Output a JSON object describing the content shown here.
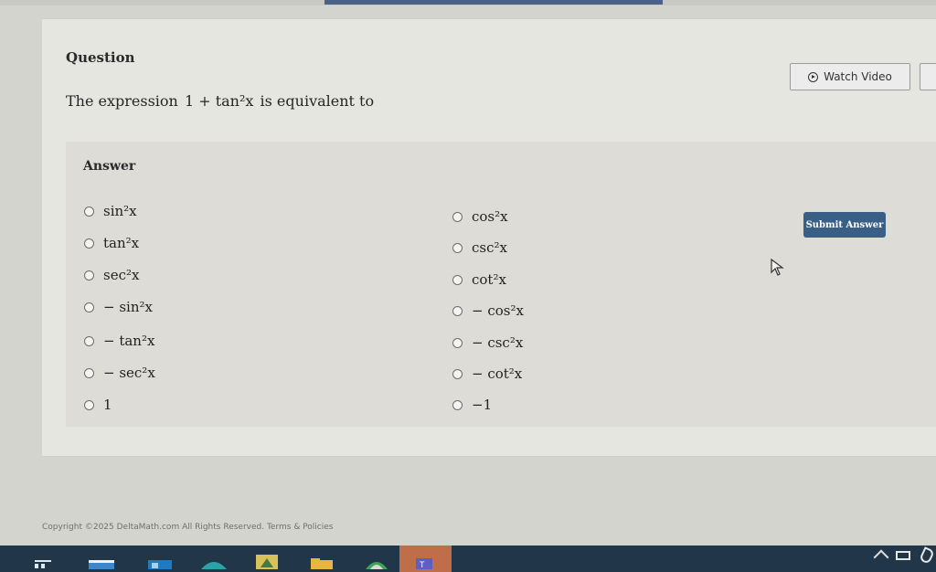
{
  "question": {
    "label": "Question",
    "prompt_prefix": "The expression",
    "prompt_math": "1 + tan²x",
    "prompt_suffix": "is equivalent to"
  },
  "watch_video": {
    "label": "Watch Video",
    "icon": "play-circle-icon"
  },
  "answer": {
    "label": "Answer",
    "options_left": [
      "sin²x",
      "tan²x",
      "sec²x",
      "− sin²x",
      "− tan²x",
      "− sec²x",
      "1"
    ],
    "options_right": [
      "cos²x",
      "csc²x",
      "cot²x",
      "− cos²x",
      "− csc²x",
      "− cot²x",
      "−1"
    ]
  },
  "submit": {
    "label": "Submit Answer"
  },
  "footer": {
    "text": "Copyright ©2025 DeltaMath.com All Rights Reserved. Terms & Policies"
  },
  "colors": {
    "primary_button": "#3a5f86",
    "taskbar": "#22364a",
    "page_bg": "#e6e6e1"
  },
  "taskbar": {
    "icons": [
      "task-view-icon",
      "store-icon",
      "mail-icon",
      "edge-icon",
      "app-icon",
      "files-icon",
      "chrome-icon",
      "teams-icon"
    ]
  }
}
